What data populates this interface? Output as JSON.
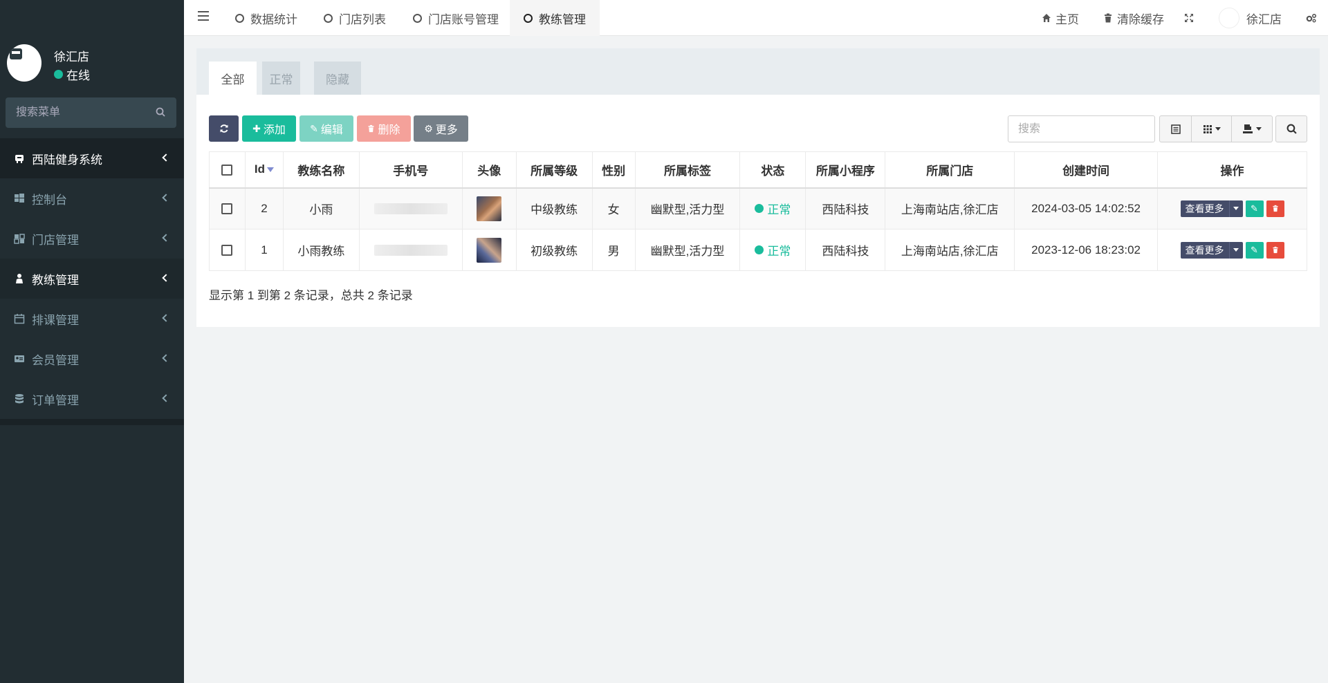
{
  "sidebar": {
    "user_name": "徐汇店",
    "user_status": "在线",
    "search_placeholder": "搜索菜单",
    "items": [
      {
        "label": "西陆健身系统"
      },
      {
        "label": "控制台"
      },
      {
        "label": "门店管理"
      },
      {
        "label": "教练管理"
      },
      {
        "label": "排课管理"
      },
      {
        "label": "会员管理"
      },
      {
        "label": "订单管理"
      }
    ]
  },
  "topbar": {
    "tabs": [
      {
        "label": "数据统计"
      },
      {
        "label": "门店列表"
      },
      {
        "label": "门店账号管理"
      },
      {
        "label": "教练管理"
      }
    ],
    "home": "主页",
    "clear_cache": "清除缓存",
    "user": "徐汇店"
  },
  "subtabs": [
    "全部",
    "正常",
    "隐藏"
  ],
  "toolbar": {
    "add": "添加",
    "edit": "编辑",
    "delete": "删除",
    "more": "更多",
    "search_placeholder": "搜索"
  },
  "table": {
    "headers": [
      "Id",
      "教练名称",
      "手机号",
      "头像",
      "所属等级",
      "性别",
      "所属标签",
      "状态",
      "所属小程序",
      "所属门店",
      "创建时间",
      "操作"
    ],
    "rows": [
      {
        "id": "2",
        "name": "小雨",
        "level": "中级教练",
        "gender": "女",
        "tags": "幽默型,活力型",
        "status": "正常",
        "app": "西陆科技",
        "store": "上海南站店,徐汇店",
        "created": "2024-03-05 14:02:52",
        "op_more": "查看更多"
      },
      {
        "id": "1",
        "name": "小雨教练",
        "level": "初级教练",
        "gender": "男",
        "tags": "幽默型,活力型",
        "status": "正常",
        "app": "西陆科技",
        "store": "上海南站店,徐汇店",
        "created": "2023-12-06 18:23:02",
        "op_more": "查看更多"
      }
    ]
  },
  "summary": "显示第 1 到第 2 条记录，总共 2 条记录",
  "colors": {
    "accent": "#1abc9c",
    "sidebar": "#222d32",
    "danger": "#e74c3c",
    "primary": "#444c69"
  }
}
